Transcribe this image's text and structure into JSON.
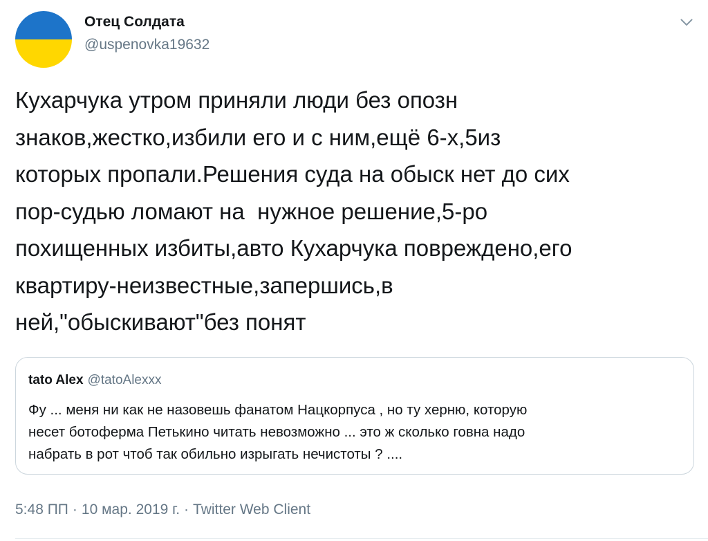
{
  "colors": {
    "flag_blue": "#1d74c9",
    "flag_yellow": "#ffd700",
    "text_primary": "#14171a",
    "text_secondary": "#657786",
    "border": "#ccd6dd"
  },
  "author": {
    "display_name": "Отец Солдата",
    "handle": "@uspenovka19632",
    "avatar_icon": "ukraine-flag-avatar"
  },
  "menu": {
    "icon": "chevron-down-icon"
  },
  "tweet": {
    "text": "Кухарчука утром приняли люди без опозн\nзнаков,жестко,избили его и с ним,ещё 6-х,5из\nкоторых пропали.Решения суда на обыск нет до сих\nпор-судью ломают на  нужное решение,5-ро\nпохищенных избиты,авто Кухарчука повреждено,его\nквартиру-неизвестные,запершись,в\nней,\"обыскивают\"без понят"
  },
  "quoted_tweet": {
    "display_name": "tato Alex",
    "handle": "@tatoAlexxx",
    "text": "Фу ... меня ни как не назовешь фанатом Нацкорпуса , но ту херню, которую\nнесет ботоферма Петькино читать невозможно ... это ж сколько говна надо\nнабрать в рот чтоб так обильно изрыгать нечистоты ? ...."
  },
  "meta": {
    "time": "5:48 ПП",
    "separator": "·",
    "date": "10 мар. 2019 г.",
    "client": "Twitter Web Client"
  }
}
